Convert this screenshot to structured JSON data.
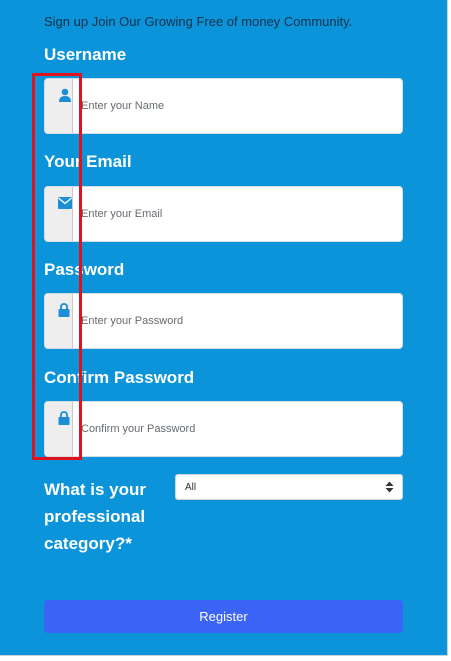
{
  "intro": "Sign up Join Our Growing Free of money Community.",
  "fields": [
    {
      "label": "Username",
      "placeholder": "Enter your Name",
      "icon": "user-icon"
    },
    {
      "label": "Your Email",
      "placeholder": "Enter your Email",
      "icon": "envelope-icon"
    },
    {
      "label": "Password",
      "placeholder": "Enter your Password",
      "icon": "lock-icon"
    },
    {
      "label": "Confirm Password",
      "placeholder": "Confirm your Password",
      "icon": "lock-icon"
    }
  ],
  "category": {
    "label": "What is your professional category?*",
    "selected": "All"
  },
  "register_label": "Register",
  "colors": {
    "panel": "#0b94d9",
    "button": "#3b63f5",
    "icon": "#1a8fd6",
    "highlight": "#e0131c"
  }
}
